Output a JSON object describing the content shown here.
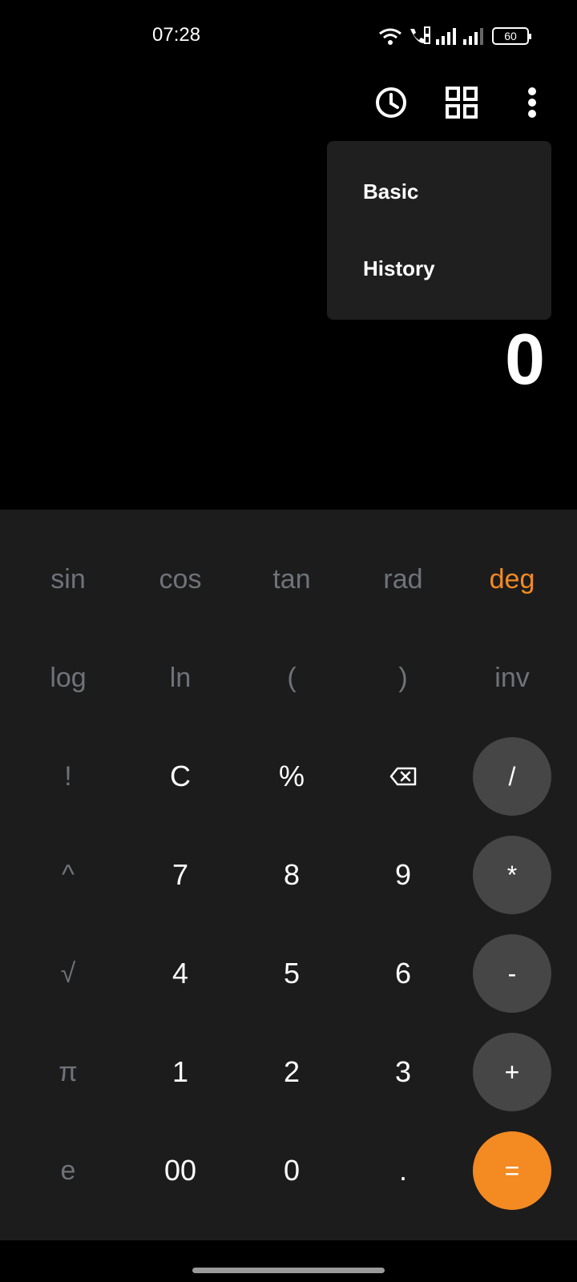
{
  "status_bar": {
    "time": "07:28",
    "battery": "60"
  },
  "toolbar": {
    "history_icon": "clock-icon",
    "mode_icon": "grid-icon",
    "more_icon": "more-vertical-icon"
  },
  "menu": {
    "items": [
      "Basic",
      "History"
    ]
  },
  "display": {
    "value": "0"
  },
  "keypad": {
    "row1": [
      "sin",
      "cos",
      "tan",
      "rad",
      "deg"
    ],
    "row2": [
      "log",
      "ln",
      "(",
      ")",
      "inv"
    ],
    "row3": [
      "!",
      "C",
      "%",
      "",
      "/"
    ],
    "row4": [
      "^",
      "7",
      "8",
      "9",
      "*"
    ],
    "row5": [
      "√",
      "4",
      "5",
      "6",
      "-"
    ],
    "row6": [
      "π",
      "1",
      "2",
      "3",
      "+"
    ],
    "row7": [
      "e",
      "00",
      "0",
      ".",
      "="
    ]
  },
  "colors": {
    "accent": "#f38a22",
    "keypad_bg": "#1c1c1c",
    "operator_bg": "#464646",
    "function_text": "#6f7379"
  }
}
